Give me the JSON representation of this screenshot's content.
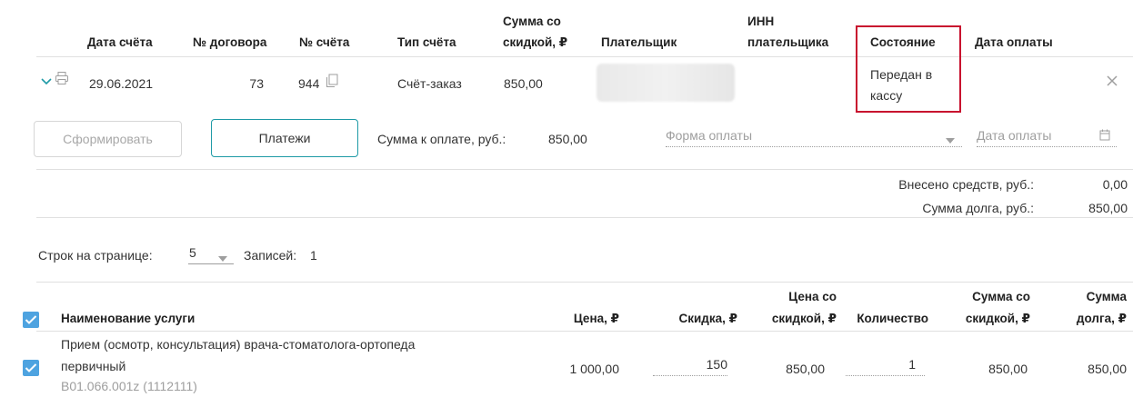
{
  "invoice_table": {
    "headers": {
      "date": "Дата счёта",
      "contract": "№ договора",
      "invoice": "№ счёта",
      "type": "Тип счёта",
      "sum_line1": "Сумма со",
      "sum_line2": "скидкой, ₽",
      "payer": "Плательщик",
      "inn_line1": "ИНН",
      "inn_line2": "плательщика",
      "status": "Состояние",
      "pay_date": "Дата оплаты"
    },
    "row": {
      "date": "29.06.2021",
      "contract": "73",
      "invoice": "944",
      "type": "Счёт-заказ",
      "sum": "850,00",
      "status_line1": "Передан в",
      "status_line2": "кассу"
    }
  },
  "details": {
    "form_button": "Сформировать",
    "payments_button": "Платежи",
    "sum_to_pay_label": "Сумма к оплате, руб.:",
    "sum_to_pay_value": "850,00",
    "payment_form_placeholder": "Форма оплаты",
    "payment_date_placeholder": "Дата оплаты",
    "deposited_label": "Внесено средств, руб.:",
    "deposited_value": "0,00",
    "debt_label": "Сумма долга, руб.:",
    "debt_value": "850,00"
  },
  "pagination": {
    "rows_per_page_label": "Строк на странице:",
    "rows_per_page_value": "5",
    "records_label": "Записей:",
    "records_value": "1"
  },
  "services_table": {
    "headers": {
      "name": "Наименование услуги",
      "price": "Цена, ₽",
      "discount": "Скидка, ₽",
      "discounted_line1": "Цена со",
      "discounted_line2": "скидкой, ₽",
      "quantity": "Количество",
      "sum_line1": "Сумма со",
      "sum_line2": "скидкой, ₽",
      "debt_line1": "Сумма",
      "debt_line2": "долга, ₽"
    },
    "rows": [
      {
        "name_line1": "Прием (осмотр, консультация) врача-стоматолога-ортопеда",
        "name_line2": "первичный",
        "code": "B01.066.001z (1112111)",
        "price": "1 000,00",
        "discount": "150",
        "discounted_price": "850,00",
        "quantity": "1",
        "sum": "850,00",
        "debt": "850,00"
      }
    ]
  },
  "colors": {
    "accent": "#1e9aa6",
    "checkbox": "#4ea3e0",
    "highlight": "#c8102e"
  }
}
